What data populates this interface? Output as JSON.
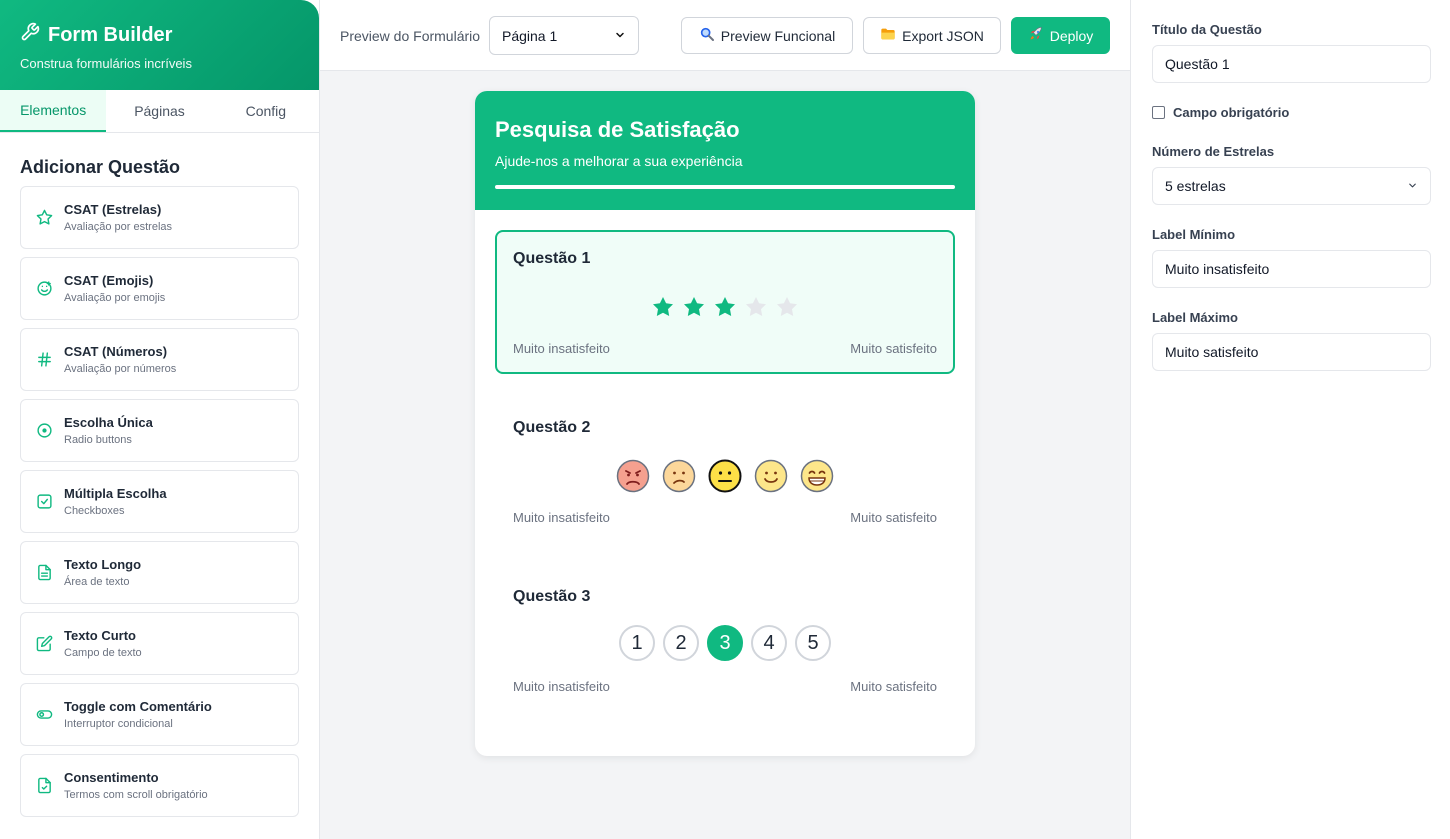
{
  "sidebar": {
    "brand_title": "Form Builder",
    "brand_subtitle": "Construa formulários incríveis",
    "tabs": [
      {
        "label": "Elementos",
        "active": true
      },
      {
        "label": "Páginas",
        "active": false
      },
      {
        "label": "Config",
        "active": false
      }
    ],
    "section_title": "Adicionar Questão",
    "elements": [
      {
        "name": "CSAT (Estrelas)",
        "desc": "Avaliação por estrelas",
        "icon": "star-icon"
      },
      {
        "name": "CSAT (Emojis)",
        "desc": "Avaliação por emojis",
        "icon": "smile-icon"
      },
      {
        "name": "CSAT (Números)",
        "desc": "Avaliação por números",
        "icon": "hash-icon"
      },
      {
        "name": "Escolha Única",
        "desc": "Radio buttons",
        "icon": "radio-icon"
      },
      {
        "name": "Múltipla Escolha",
        "desc": "Checkboxes",
        "icon": "checkbox-icon"
      },
      {
        "name": "Texto Longo",
        "desc": "Área de texto",
        "icon": "document-icon"
      },
      {
        "name": "Texto Curto",
        "desc": "Campo de texto",
        "icon": "edit-icon"
      },
      {
        "name": "Toggle com Comentário",
        "desc": "Interruptor condicional",
        "icon": "toggle-icon"
      },
      {
        "name": "Consentimento",
        "desc": "Termos com scroll obrigatório",
        "icon": "file-check-icon"
      }
    ]
  },
  "toolbar": {
    "preview_label": "Preview do Formulário",
    "page_select_value": "Página 1",
    "preview_button": "Preview Funcional",
    "export_button": "Export JSON",
    "deploy_button": "Deploy"
  },
  "form": {
    "title": "Pesquisa de Satisfação",
    "subtitle": "Ajude-nos a melhorar a sua experiência",
    "progress": 1.0,
    "questions": [
      {
        "title": "Questão 1",
        "type": "stars",
        "value": 3,
        "max": 5,
        "min_label": "Muito insatisfeito",
        "max_label": "Muito satisfeito"
      },
      {
        "title": "Questão 2",
        "type": "emojis",
        "value": 3,
        "max": 5,
        "min_label": "Muito insatisfeito",
        "max_label": "Muito satisfeito"
      },
      {
        "title": "Questão 3",
        "type": "numbers",
        "value": 3,
        "options": [
          "1",
          "2",
          "3",
          "4",
          "5"
        ],
        "min_label": "Muito insatisfeito",
        "max_label": "Muito satisfeito"
      }
    ]
  },
  "properties": {
    "title_label": "Título da Questão",
    "title_value": "Questão 1",
    "required_label": "Campo obrigatório",
    "required_checked": false,
    "stars_label": "Número de Estrelas",
    "stars_value": "5 estrelas",
    "min_label": "Label Mínimo",
    "min_value": "Muito insatisfeito",
    "max_label": "Label Máximo",
    "max_value": "Muito satisfeito"
  },
  "colors": {
    "accent": "#10b981",
    "star_empty": "#e5e7eb"
  }
}
